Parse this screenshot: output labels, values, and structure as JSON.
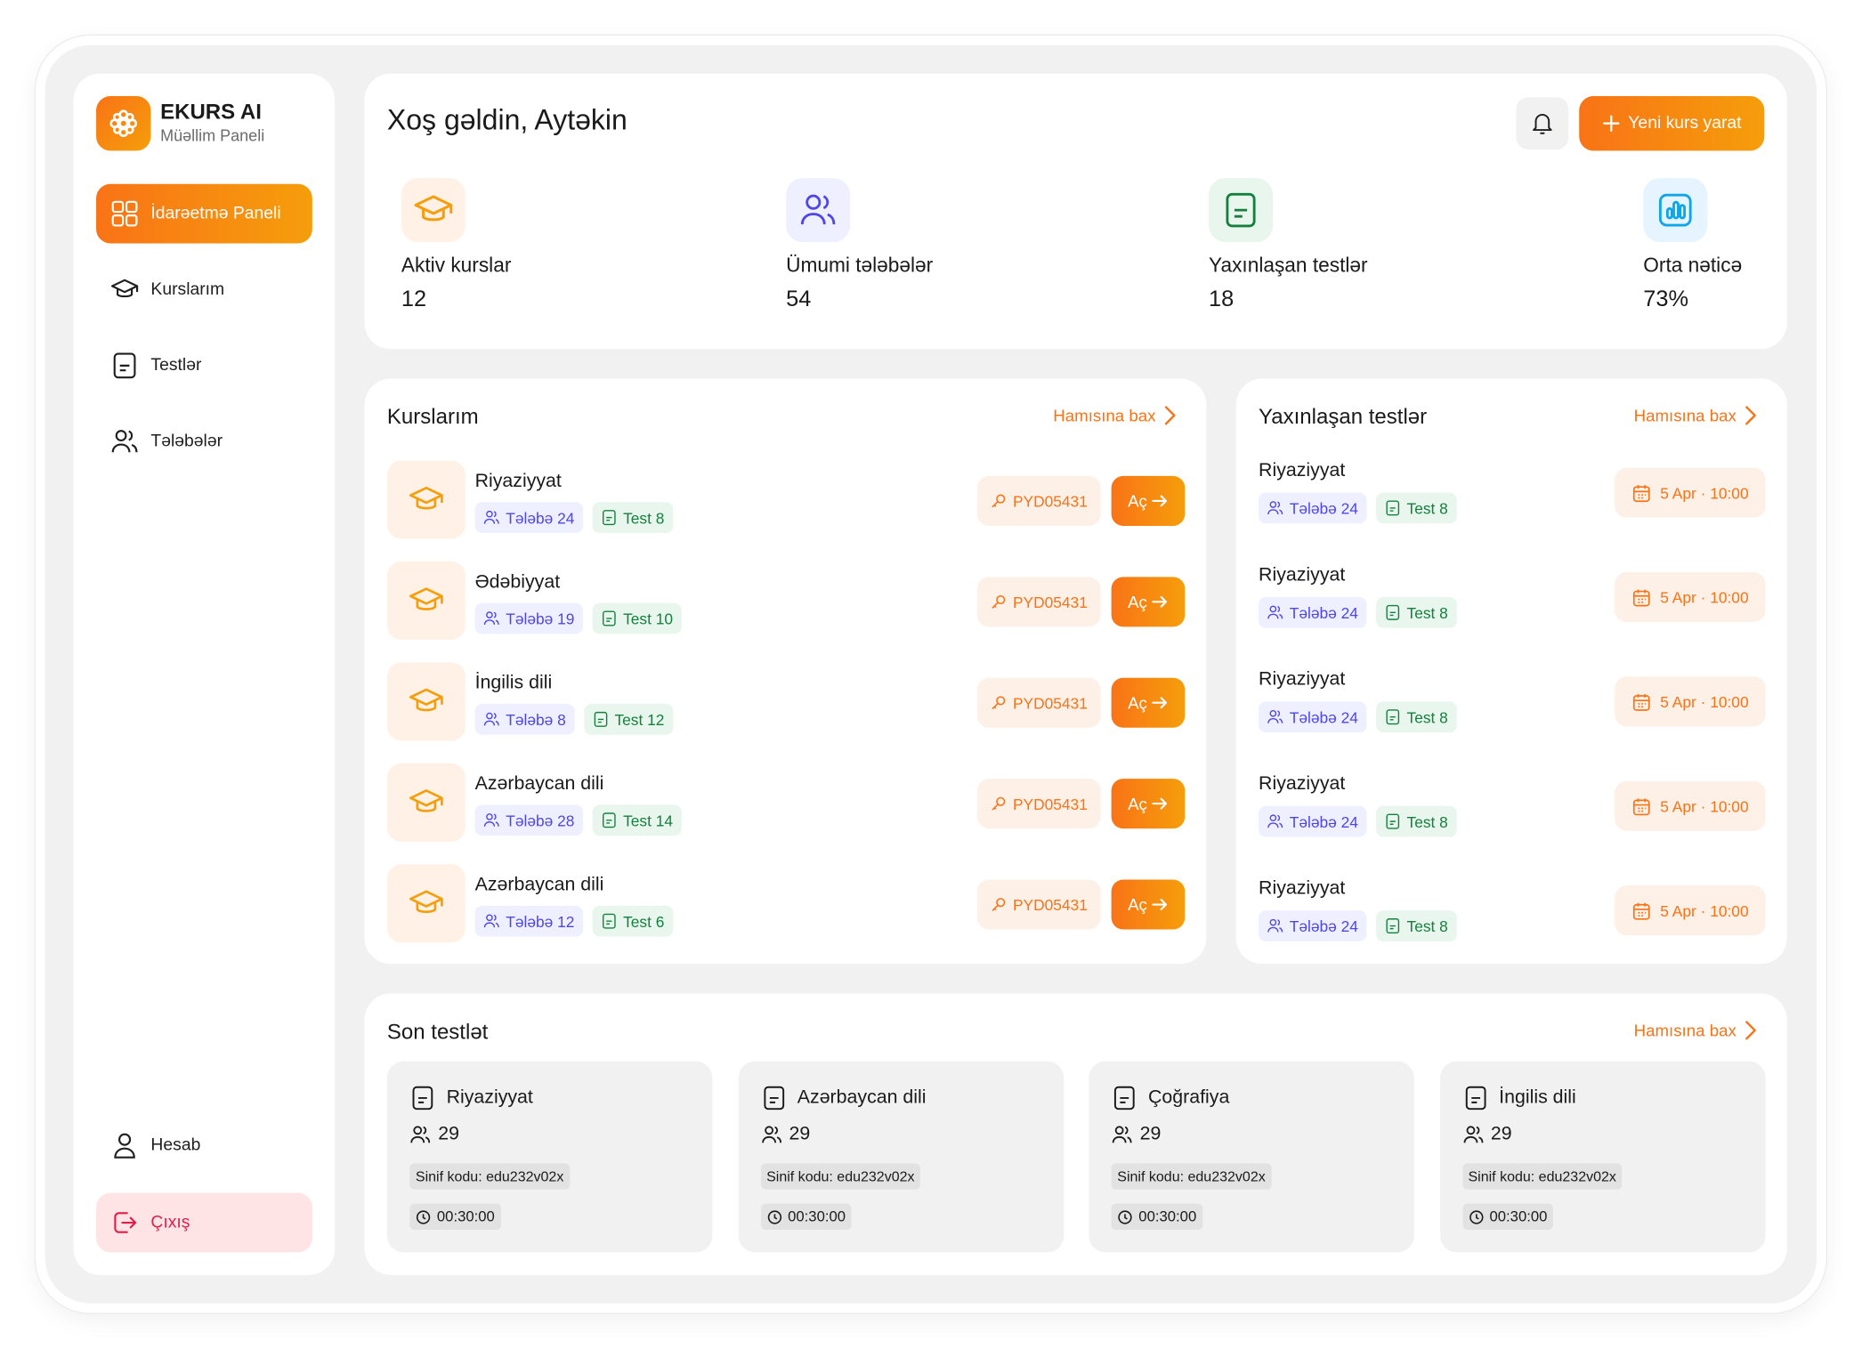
{
  "brand": {
    "name": "EKURS AI",
    "subtitle": "Müəllim Paneli"
  },
  "sidebar": {
    "items": [
      {
        "label": "İdarəetmə Paneli",
        "icon": "dashboard-grid-icon",
        "active": true
      },
      {
        "label": "Kurslarım",
        "icon": "graduation-cap-icon"
      },
      {
        "label": "Testlər",
        "icon": "document-icon"
      },
      {
        "label": "Tələbələr",
        "icon": "users-icon"
      }
    ],
    "account": {
      "label": "Hesab",
      "icon": "user-icon"
    },
    "logout": {
      "label": "Çıxış",
      "icon": "logout-icon"
    }
  },
  "header": {
    "welcome": "Xoş gəldin, Aytəkin",
    "new_course_label": "Yeni kurs yarat",
    "stats": [
      {
        "label": "Aktiv kurslar",
        "value": "12",
        "icon": "graduation-cap-icon"
      },
      {
        "label": "Ümumi tələbələr",
        "value": "54",
        "icon": "users-icon"
      },
      {
        "label": "Yaxınlaşan testlər",
        "value": "18",
        "icon": "document-icon"
      },
      {
        "label": "Orta nəticə",
        "value": "73%",
        "icon": "chart-icon"
      }
    ]
  },
  "courses": {
    "title": "Kurslarım",
    "see_all": "Hamısına bax",
    "items": [
      {
        "name": "Riyaziyyat",
        "students": "Tələbə 24",
        "tests": "Test 8",
        "code": "PYD05431",
        "open_label": "Aç"
      },
      {
        "name": "Ədəbiyyat",
        "students": "Tələbə 19",
        "tests": "Test 10",
        "code": "PYD05431",
        "open_label": "Aç"
      },
      {
        "name": "İngilis dili",
        "students": "Tələbə 8",
        "tests": "Test 12",
        "code": "PYD05431",
        "open_label": "Aç"
      },
      {
        "name": "Azərbaycan dili",
        "students": "Tələbə 28",
        "tests": "Test 14",
        "code": "PYD05431",
        "open_label": "Aç"
      },
      {
        "name": "Azərbaycan dili",
        "students": "Tələbə 12",
        "tests": "Test 6",
        "code": "PYD05431",
        "open_label": "Aç"
      }
    ]
  },
  "upcoming_tests": {
    "title": "Yaxınlaşan testlər",
    "see_all": "Hamısına bax",
    "items": [
      {
        "name": "Riyaziyyat",
        "students": "Tələbə 24",
        "tests": "Test 8",
        "date": "5 Apr · 10:00"
      },
      {
        "name": "Riyaziyyat",
        "students": "Tələbə 24",
        "tests": "Test 8",
        "date": "5 Apr · 10:00"
      },
      {
        "name": "Riyaziyyat",
        "students": "Tələbə 24",
        "tests": "Test 8",
        "date": "5 Apr · 10:00"
      },
      {
        "name": "Riyaziyyat",
        "students": "Tələbə 24",
        "tests": "Test 8",
        "date": "5 Apr · 10:00"
      },
      {
        "name": "Riyaziyyat",
        "students": "Tələbə 24",
        "tests": "Test 8",
        "date": "5 Apr · 10:00"
      }
    ]
  },
  "recent_tests": {
    "title": "Son testlət",
    "see_all": "Hamısına bax",
    "items": [
      {
        "name": "Riyaziyyat",
        "count": "29",
        "code": "Sinif kodu: edu232v02x",
        "time": "00:30:00"
      },
      {
        "name": "Azərbaycan dili",
        "count": "29",
        "code": "Sinif kodu: edu232v02x",
        "time": "00:30:00"
      },
      {
        "name": "Çoğrafiya",
        "count": "29",
        "code": "Sinif kodu: edu232v02x",
        "time": "00:30:00"
      },
      {
        "name": "İngilis dili",
        "count": "29",
        "code": "Sinif kodu: edu232v02x",
        "time": "00:30:00"
      }
    ]
  },
  "colors": {
    "accent": "#f97316",
    "accent_end": "#f59e0b",
    "student_chip": "#4f46e5",
    "test_chip": "#15803d",
    "logout": "#e11d48"
  }
}
